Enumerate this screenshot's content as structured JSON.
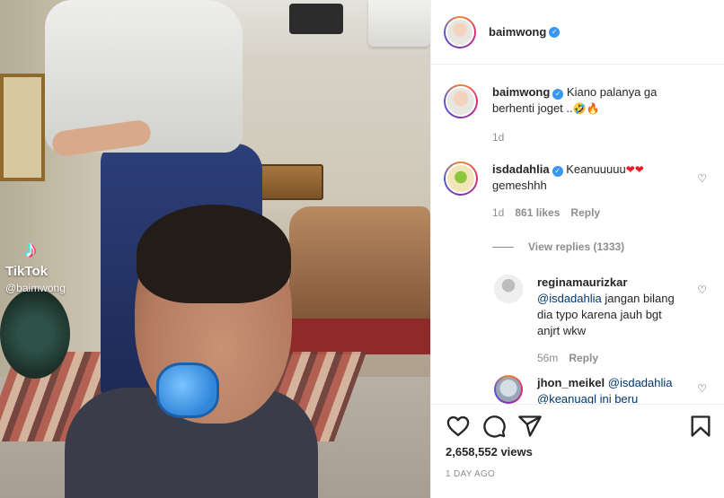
{
  "media": {
    "watermark_brand": "TikTok",
    "watermark_handle": "@baimwong",
    "tiktok_logo_glyph": "♪"
  },
  "header": {
    "username": "baimwong",
    "verified": true
  },
  "caption": {
    "username": "baimwong",
    "text": "Kiano palanya ga berhenti joget ..",
    "emojis": "🤣🔥",
    "time": "1d"
  },
  "comments": [
    {
      "username": "isdadahlia",
      "verified": true,
      "text": "Keanuuuuu",
      "emojis": "❤❤",
      "text2": "gemeshhh",
      "time": "1d",
      "likes": "861 likes",
      "reply_label": "Reply"
    }
  ],
  "view_replies": "View replies (1333)",
  "replies": [
    {
      "username": "reginamaurizkar",
      "mention": "@isdadahlia",
      "text": "jangan bilang dia typo karena jauh bgt anjrt wkw",
      "time": "56m",
      "reply_label": "Reply"
    },
    {
      "username": "jhon_meikel",
      "mention": "@isdadahlia",
      "text": "@keanuagl ini beru"
    }
  ],
  "actions": {
    "views": "2,658,552 views",
    "date": "1 DAY AGO",
    "icons": [
      "heart-icon",
      "comment-icon",
      "share-icon",
      "bookmark-icon"
    ]
  },
  "colors": {
    "verified": "#3897f0",
    "meta_text": "#8e8e8e",
    "mention": "#00376b",
    "heart_emoji": "#ed1c24"
  }
}
